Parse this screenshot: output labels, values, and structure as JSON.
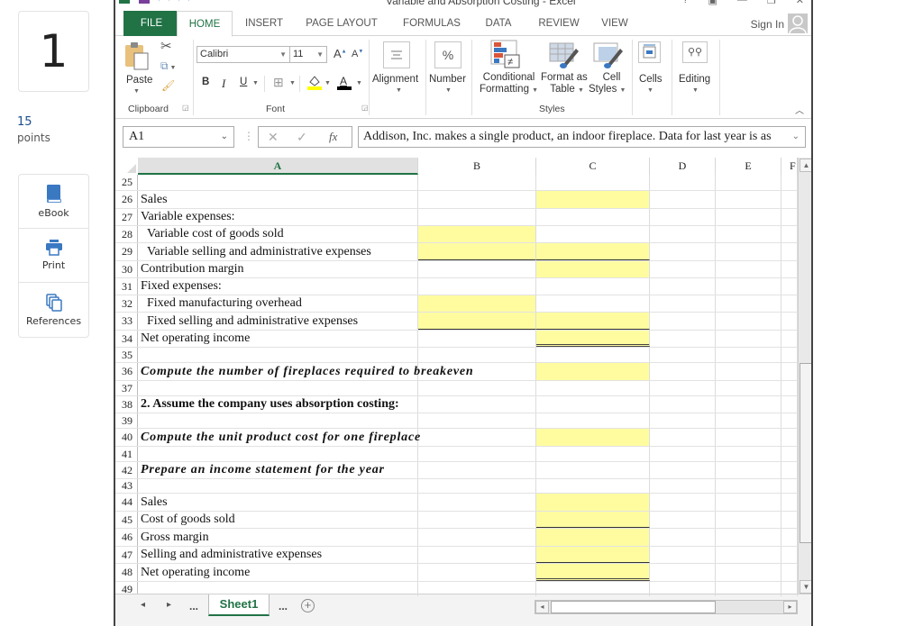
{
  "question": {
    "number": "1",
    "points_value": "15",
    "points_label": "points"
  },
  "tools": [
    {
      "label": "eBook",
      "icon": "book-icon"
    },
    {
      "label": "Print",
      "icon": "printer-icon"
    },
    {
      "label": "References",
      "icon": "copy-documents-icon"
    }
  ],
  "excel": {
    "title": "Variable and Absorption Costing - Excel",
    "tabs": [
      "FILE",
      "HOME",
      "INSERT",
      "PAGE LAYOUT",
      "FORMULAS",
      "DATA",
      "REVIEW",
      "VIEW"
    ],
    "active_tab": "HOME",
    "sign_in": "Sign In",
    "ribbon": {
      "paste": "Paste",
      "font_name": "Calibri",
      "font_size": "11",
      "bold": "B",
      "italic": "I",
      "underline": "U",
      "alignment": "Alignment",
      "number": "Number",
      "conditional_formatting_1": "Conditional",
      "conditional_formatting_2": "Formatting",
      "format_as_table_1": "Format as",
      "format_as_table_2": "Table",
      "cell_styles_1": "Cell",
      "cell_styles_2": "Styles",
      "cells": "Cells",
      "editing": "Editing",
      "groups": {
        "clipboard": "Clipboard",
        "font": "Font",
        "styles": "Styles"
      }
    },
    "name_box": "A1",
    "formula": "Addison, Inc. makes a single product, an indoor fireplace. Data for last year is as",
    "columns": [
      "A",
      "B",
      "C",
      "D",
      "E",
      "F"
    ],
    "selected_column": "A",
    "rows": [
      {
        "num": "25",
        "a": ""
      },
      {
        "num": "26",
        "a": "Sales"
      },
      {
        "num": "27",
        "a": "Variable expenses:"
      },
      {
        "num": "28",
        "a": "Variable cost of goods sold"
      },
      {
        "num": "29",
        "a": "Variable selling and administrative expenses"
      },
      {
        "num": "30",
        "a": "Contribution margin"
      },
      {
        "num": "31",
        "a": "Fixed expenses:"
      },
      {
        "num": "32",
        "a": "Fixed manufacturing overhead"
      },
      {
        "num": "33",
        "a": "Fixed selling and administrative expenses"
      },
      {
        "num": "34",
        "a": "Net operating income"
      },
      {
        "num": "35",
        "a": ""
      },
      {
        "num": "36",
        "a": "Compute the number of fireplaces required to breakeven"
      },
      {
        "num": "37",
        "a": ""
      },
      {
        "num": "38",
        "a": "2. Assume the company uses absorption costing:"
      },
      {
        "num": "39",
        "a": ""
      },
      {
        "num": "40",
        "a": "Compute the unit product cost for one fireplace"
      },
      {
        "num": "41",
        "a": ""
      },
      {
        "num": "42",
        "a": "Prepare an income statement for the year"
      },
      {
        "num": "43",
        "a": ""
      },
      {
        "num": "44",
        "a": "Sales"
      },
      {
        "num": "45",
        "a": "Cost of goods sold"
      },
      {
        "num": "46",
        "a": "Gross margin"
      },
      {
        "num": "47",
        "a": "Selling and administrative expenses"
      },
      {
        "num": "48",
        "a": "Net operating income"
      },
      {
        "num": "49",
        "a": ""
      }
    ],
    "sheet_tab": "Sheet1",
    "sheet_nav_more": "...",
    "colors": {
      "excel_green": "#217346",
      "input_yellow": "#fffca0"
    }
  }
}
